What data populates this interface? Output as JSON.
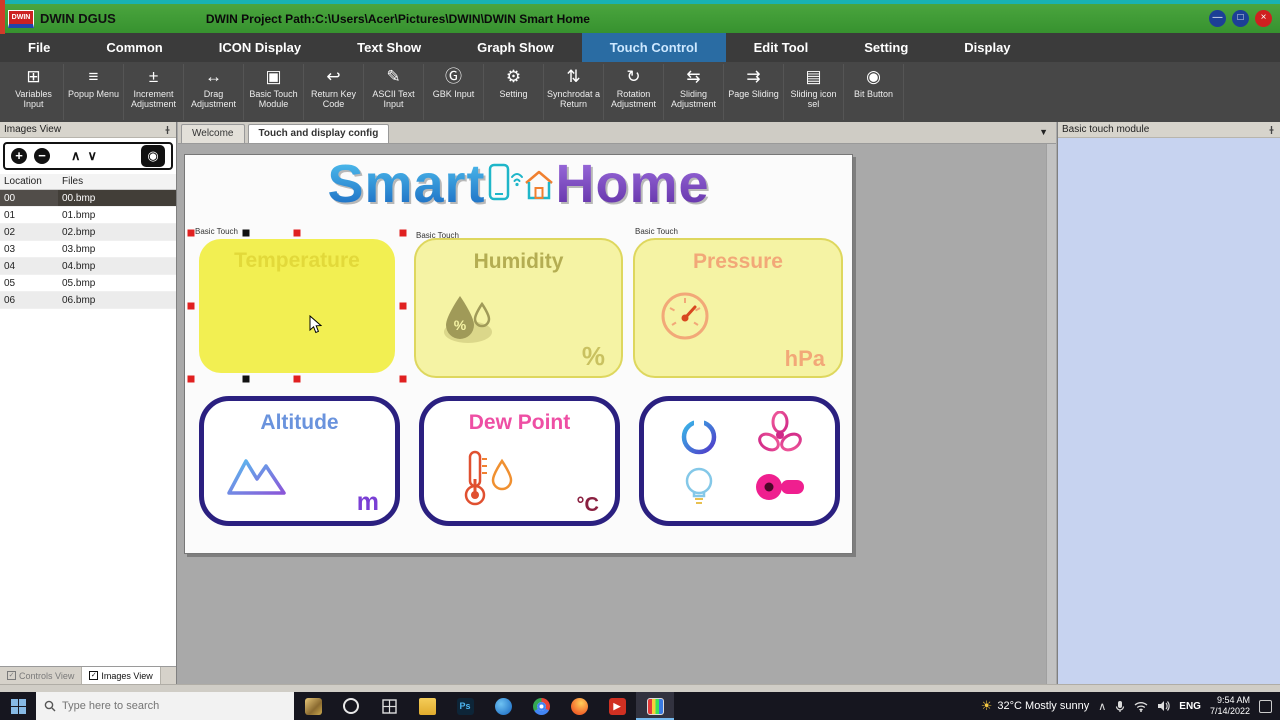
{
  "titlebar": {
    "logo_text": "DWIN",
    "app_name": "DWIN DGUS",
    "project_path": "DWIN Project Path:C:\\Users\\Acer\\Pictures\\DWIN\\DWIN Smart Home",
    "window_buttons": {
      "minimize": "—",
      "maximize": "□",
      "close": "×"
    }
  },
  "menubar": {
    "items": [
      "File",
      "Common",
      "ICON Display",
      "Text Show",
      "Graph Show",
      "Touch Control",
      "Edit Tool",
      "Setting",
      "Display"
    ]
  },
  "toolbar": {
    "buttons": [
      {
        "glyph": "⊞",
        "label": "Variables Input"
      },
      {
        "glyph": "≡",
        "label": "Popup Menu"
      },
      {
        "glyph": "±",
        "label": "Increment Adjustment"
      },
      {
        "glyph": "↔",
        "label": "Drag Adjustment"
      },
      {
        "glyph": "▣",
        "label": "Basic Touch Module"
      },
      {
        "glyph": "↩",
        "label": "Return Key Code"
      },
      {
        "glyph": "✎",
        "label": "ASCII Text Input"
      },
      {
        "glyph": "Ⓖ",
        "label": "GBK Input"
      },
      {
        "glyph": "⚙",
        "label": "Setting"
      },
      {
        "glyph": "⇅",
        "label": "Synchrodat a Return"
      },
      {
        "glyph": "↻",
        "label": "Rotation Adjustment"
      },
      {
        "glyph": "⇆",
        "label": "Sliding Adjustment"
      },
      {
        "glyph": "⇉",
        "label": "Page Sliding"
      },
      {
        "glyph": "▤",
        "label": "Sliding icon sel"
      },
      {
        "glyph": "◉",
        "label": "Bit Button"
      }
    ]
  },
  "images_panel": {
    "title": "Images View",
    "columns": {
      "location": "Location",
      "files": "Files"
    },
    "rows": [
      {
        "location": "00",
        "file": "00.bmp"
      },
      {
        "location": "01",
        "file": "01.bmp"
      },
      {
        "location": "02",
        "file": "02.bmp"
      },
      {
        "location": "03",
        "file": "03.bmp"
      },
      {
        "location": "04",
        "file": "04.bmp"
      },
      {
        "location": "05",
        "file": "05.bmp"
      },
      {
        "location": "06",
        "file": "06.bmp"
      }
    ],
    "bottom_tabs": [
      "Controls View",
      "Images View"
    ]
  },
  "doc_tabs": {
    "tabs": [
      "Welcome",
      "Touch and display config"
    ]
  },
  "right_panel": {
    "title": "Basic touch module"
  },
  "canvas": {
    "title_left": "Smart",
    "title_right": "Home",
    "group_label": "Basic Touch",
    "cards": [
      {
        "name": "Temperature",
        "unit": ""
      },
      {
        "name": "Humidity",
        "unit": "%"
      },
      {
        "name": "Pressure",
        "unit": "hPa"
      },
      {
        "name": "Altitude",
        "unit": "m"
      },
      {
        "name": "Dew Point",
        "unit": "°C"
      }
    ]
  },
  "taskbar": {
    "search_placeholder": "Type here to search",
    "weather": "32°C  Mostly sunny",
    "language": "ENG",
    "time": "9:54 AM",
    "date": "7/14/2022"
  },
  "colors": {
    "accent_green": "#3f9e38",
    "select_red": "#e02020",
    "panel_lavender": "#c7d3f0"
  }
}
